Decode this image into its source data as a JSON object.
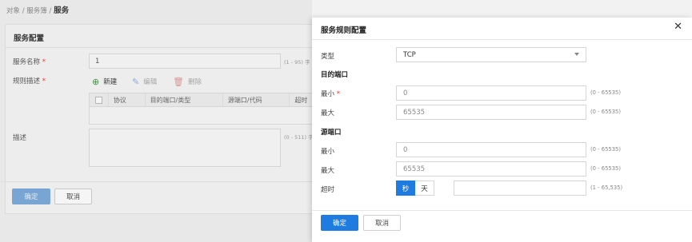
{
  "breadcrumb": {
    "items": [
      "对象",
      "服务簿"
    ],
    "separator": "/",
    "current": "服务"
  },
  "background_form": {
    "title": "服务配置",
    "service_name": {
      "label": "服务名称",
      "value": "1",
      "hint": "(1 - 95) 字"
    },
    "rule_desc": {
      "label": "规则描述"
    },
    "toolbar": {
      "new_label": "新建",
      "edit_label": "编辑",
      "delete_label": "删除"
    },
    "rule_table": {
      "columns": [
        "协议",
        "目的端口/类型",
        "源端口/代码",
        "超时"
      ]
    },
    "description": {
      "label": "描述",
      "value": "",
      "hint": "(0 - 511) 字"
    },
    "confirm_label": "确定",
    "cancel_label": "取消"
  },
  "drawer": {
    "title": "服务规则配置",
    "type": {
      "label": "类型",
      "selected": "TCP"
    },
    "dest_port": {
      "section_title": "目的端口",
      "min": {
        "label": "最小",
        "value": "0",
        "hint": "(0 - 65535)"
      },
      "max": {
        "label": "最大",
        "value": "65535",
        "hint": "(0 - 65535)"
      }
    },
    "src_port": {
      "section_title": "源端口",
      "min": {
        "label": "最小",
        "value": "0",
        "hint": "(0 - 65535)"
      },
      "max": {
        "label": "最大",
        "value": "65535",
        "hint": "(0 - 65535)"
      }
    },
    "timeout": {
      "label": "超时",
      "unit_seconds": "秒",
      "unit_days": "天",
      "value": "",
      "hint": "(1 - 65,535)"
    },
    "confirm_label": "确定",
    "cancel_label": "取消"
  },
  "colors": {
    "accent": "#1e7be0",
    "required": "#e33333"
  },
  "icons": {
    "new": "plus-circle-icon",
    "edit": "pencil-icon",
    "delete": "trash-icon",
    "close": "close-icon"
  }
}
